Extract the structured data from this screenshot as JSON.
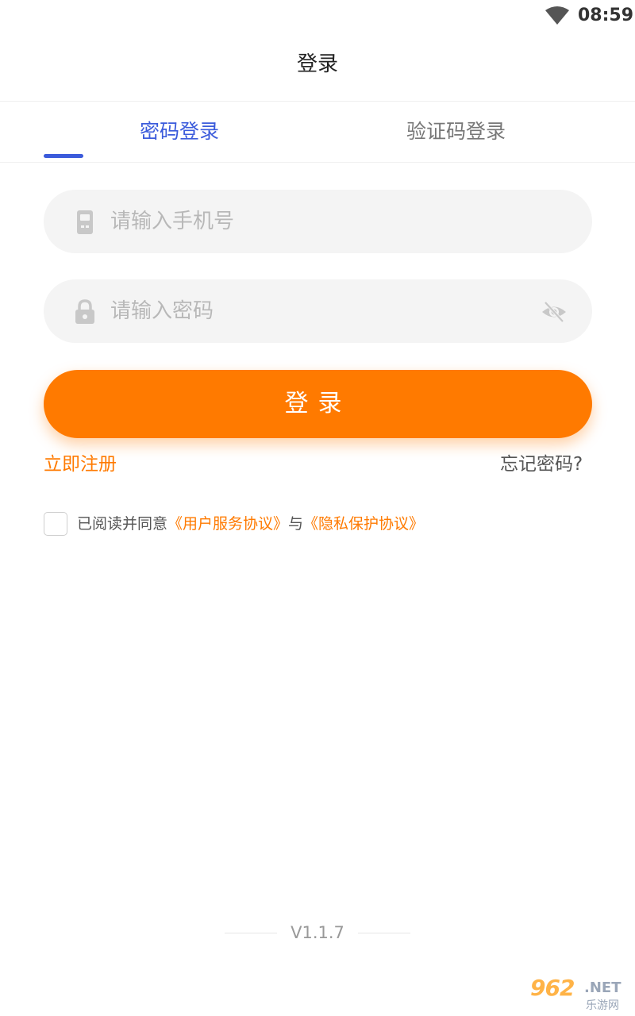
{
  "status_bar": {
    "time": "08:59",
    "wifi_icon": "wifi-icon"
  },
  "header": {
    "title": "登录"
  },
  "tabs": [
    {
      "label": "密码登录",
      "active": true
    },
    {
      "label": "验证码登录",
      "active": false
    }
  ],
  "form": {
    "phone": {
      "placeholder": "请输入手机号",
      "value": "",
      "icon": "phone-icon"
    },
    "password": {
      "placeholder": "请输入密码",
      "value": "",
      "icon": "lock-icon",
      "toggle_icon": "eye-off-icon"
    },
    "login_label": "登录",
    "register_label": "立即注册",
    "forgot_label": "忘记密码?"
  },
  "agreement": {
    "prefix": "已阅读并同意",
    "user_agreement": "《用户服务协议》",
    "conjunction": "与",
    "privacy_policy": "《隐私保护协议》",
    "checked": false
  },
  "footer": {
    "version": "V1.1.7"
  },
  "watermark": {
    "number": "962",
    "domain": ".NET",
    "site": "乐游网"
  },
  "colors": {
    "accent": "#ff7a00",
    "tab_active": "#3b5bdb",
    "field_bg": "#f4f4f4",
    "placeholder": "#b8b8b8"
  }
}
